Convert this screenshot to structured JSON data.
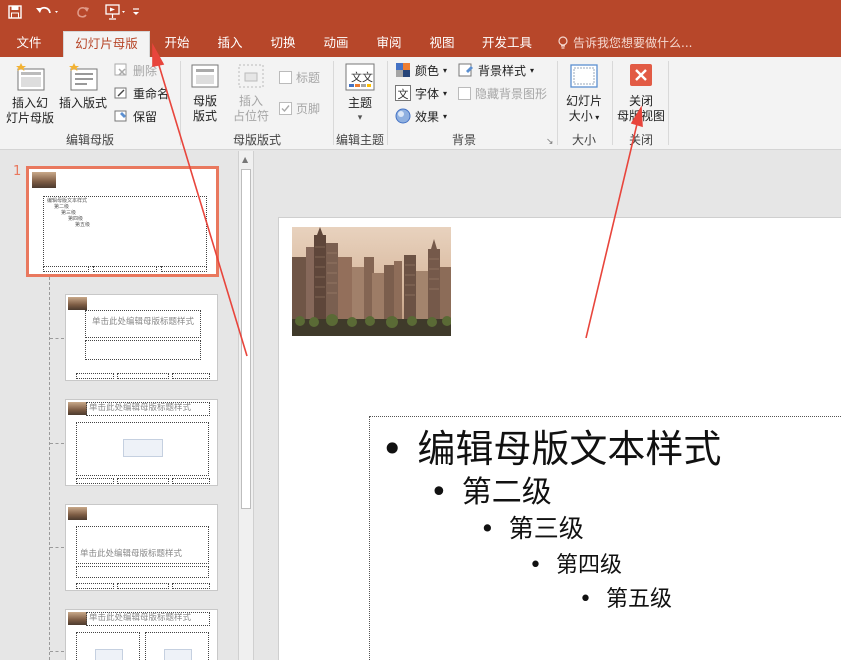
{
  "quick_access": {
    "save": "save-icon",
    "undo": "undo-icon",
    "redo": "redo-icon",
    "present": "present-from-start-icon",
    "customize": "customize-qat-icon"
  },
  "tabs": [
    {
      "label": "文件"
    },
    {
      "label": "幻灯片母版"
    },
    {
      "label": "开始"
    },
    {
      "label": "插入"
    },
    {
      "label": "切换"
    },
    {
      "label": "动画"
    },
    {
      "label": "审阅"
    },
    {
      "label": "视图"
    },
    {
      "label": "开发工具"
    }
  ],
  "tell_me": "告诉我您想要做什么...",
  "ribbon": {
    "edit_master": {
      "label": "编辑母版",
      "insert_slide_master": [
        "插入幻",
        "灯片母版"
      ],
      "insert_layout": "插入版式",
      "delete": "删除",
      "rename": "重命名",
      "preserve": "保留"
    },
    "master_layout": {
      "label": "母版版式",
      "master_layout_btn": [
        "母版",
        "版式"
      ],
      "insert_placeholder": [
        "插入",
        "占位符"
      ],
      "title": "标题",
      "footers": "页脚"
    },
    "edit_theme": {
      "label": "编辑主题",
      "themes": "主题"
    },
    "background": {
      "label": "背景",
      "colors": "颜色",
      "fonts": "字体",
      "effects": "效果",
      "bg_styles": "背景样式",
      "hide_bg": "隐藏背景图形"
    },
    "size": {
      "label": "大小",
      "slide_size": [
        "幻灯片",
        "大小"
      ]
    },
    "close": {
      "label": "关闭",
      "close_master": [
        "关闭",
        "母版视图"
      ]
    }
  },
  "thumbnails": {
    "slide_number": "1",
    "master_bullets": [
      "编辑母版文本样式",
      "第二级",
      "第三级",
      "第四级",
      "第五级"
    ],
    "layout2_title": "单击此处编辑母版标题样式",
    "layout3_title": "单击此处编辑母版标题样式",
    "layout4_title": "单击此处编辑母版标题样式",
    "layout5_title": "单击此处编辑母版标题样式"
  },
  "slide": {
    "levels": [
      "编辑母版文本样式",
      "第二级",
      "第三级",
      "第四级",
      "第五级"
    ]
  },
  "colors": {
    "accent": "#b7472a",
    "selection": "#e9785e",
    "arrow": "#e8453c"
  }
}
